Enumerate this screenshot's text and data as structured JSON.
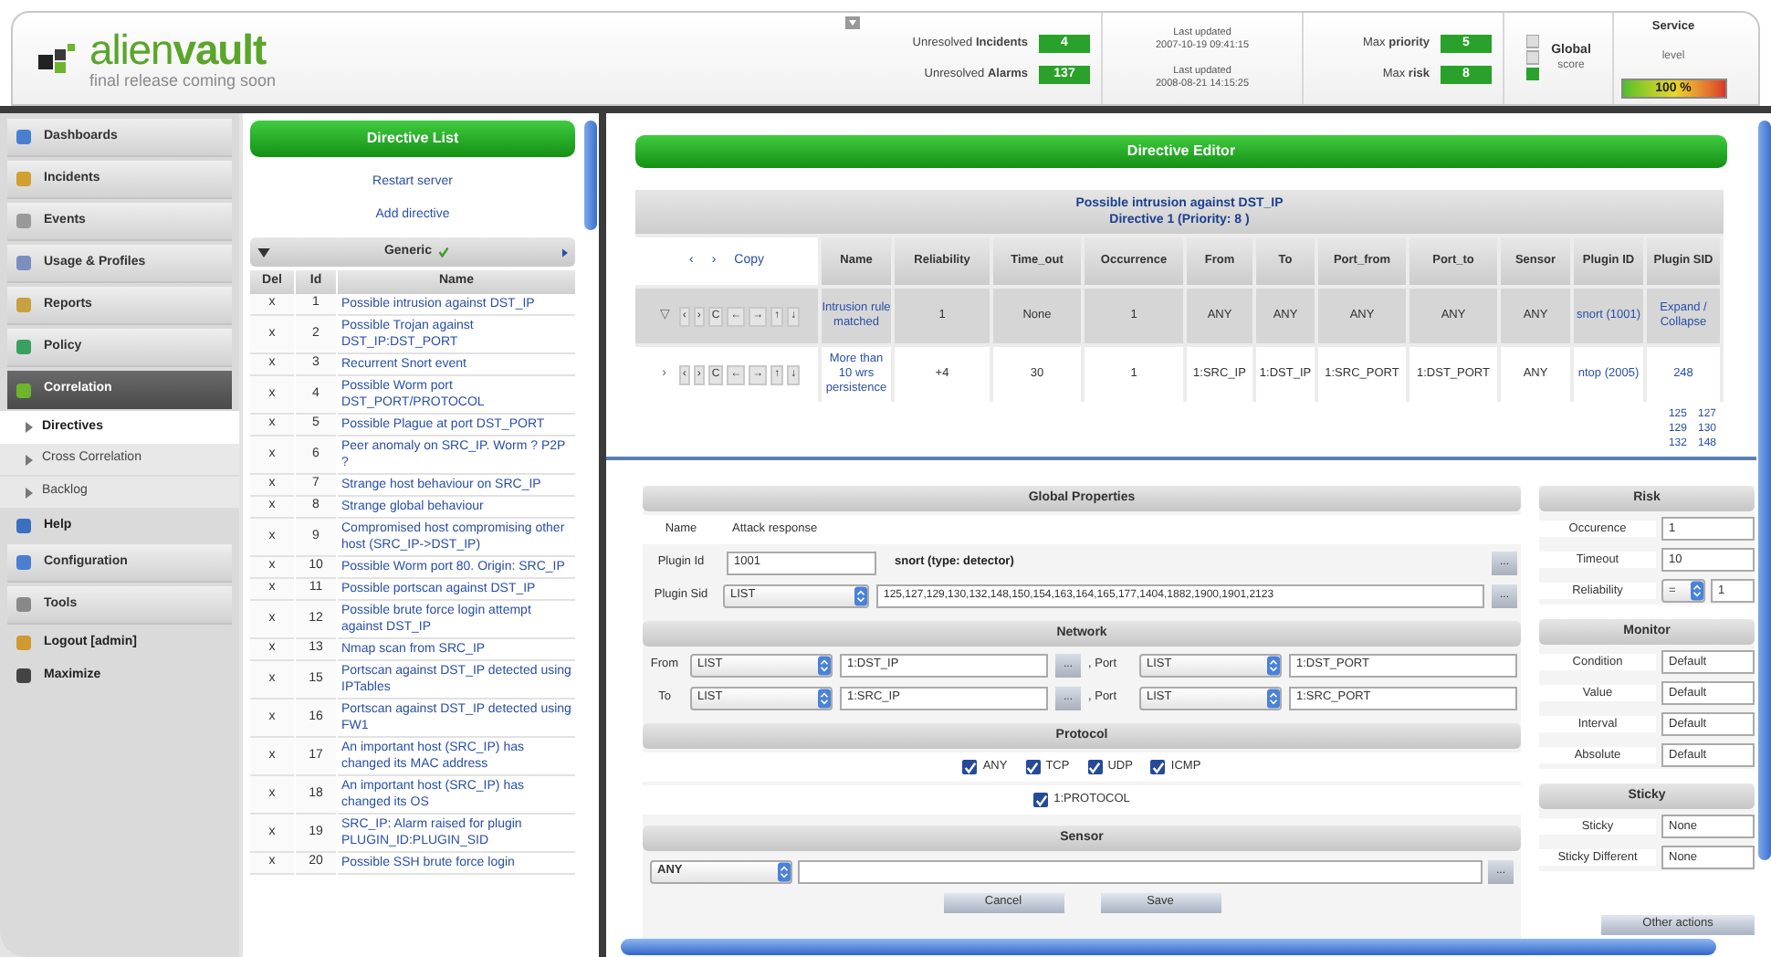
{
  "header": {
    "logo": {
      "name": "alien**vault**",
      "tagline": "final release coming soon"
    },
    "counters": [
      {
        "label": "Unresolved **Incidents**",
        "value": "4"
      },
      {
        "label": "Unresolved **Alarms**",
        "value": "137"
      }
    ],
    "updates": [
      {
        "label": "Last updated",
        "time": "2007-10-19 09:41:15"
      },
      {
        "label": "Last updated",
        "time": "2008-08-21 14:15:25"
      }
    ],
    "maxes": [
      {
        "label": "Max **priority**",
        "value": "5"
      },
      {
        "label": "Max **risk**",
        "value": "8"
      }
    ],
    "global": {
      "label": "Global",
      "sub": "score"
    },
    "service": {
      "label": "Service",
      "sub": "level",
      "value": "100 %"
    }
  },
  "sidebar": {
    "items": [
      {
        "kind": "section",
        "label": "Dashboards",
        "selected": false
      },
      {
        "kind": "section",
        "label": "Incidents",
        "selected": false
      },
      {
        "kind": "section",
        "label": "Events",
        "selected": false
      },
      {
        "kind": "section",
        "label": "Usage & Profiles",
        "selected": false
      },
      {
        "kind": "section",
        "label": "Reports",
        "selected": false
      },
      {
        "kind": "section",
        "label": "Policy",
        "selected": false
      },
      {
        "kind": "section",
        "label": "Correlation",
        "selected": true,
        "children": [
          {
            "label": "Directives",
            "selected": true
          },
          {
            "label": "Cross Correlation",
            "selected": false
          },
          {
            "label": "Backlog",
            "selected": false
          }
        ]
      },
      {
        "kind": "link",
        "label": "Help",
        "selected": false
      },
      {
        "kind": "section",
        "label": "Configuration",
        "selected": false
      },
      {
        "kind": "section",
        "label": "Tools",
        "selected": false
      },
      {
        "kind": "link",
        "label": "Logout **[admin]**",
        "selected": false
      },
      {
        "kind": "link",
        "label": "Maximize",
        "selected": false
      }
    ]
  },
  "directive_list": {
    "title": "Directive List",
    "links": [
      "Restart server",
      "Add directive"
    ],
    "group": "Generic",
    "columns": [
      "Del",
      "Id",
      "Name"
    ],
    "rows": [
      {
        "del": "x",
        "id": "1",
        "name": "Possible intrusion against DST_IP"
      },
      {
        "del": "x",
        "id": "2",
        "name": "Possible Trojan against DST_IP:DST_PORT"
      },
      {
        "del": "x",
        "id": "3",
        "name": "Recurrent Snort event"
      },
      {
        "del": "x",
        "id": "4",
        "name": "Possible Worm port DST_PORT/PROTOCOL"
      },
      {
        "del": "x",
        "id": "5",
        "name": "Possible Plague at port DST_PORT"
      },
      {
        "del": "x",
        "id": "6",
        "name": "Peer anomaly on SRC_IP. Worm ? P2P ?"
      },
      {
        "del": "x",
        "id": "7",
        "name": "Strange host behaviour on SRC_IP"
      },
      {
        "del": "x",
        "id": "8",
        "name": "Strange global behaviour"
      },
      {
        "del": "x",
        "id": "9",
        "name": "Compromised host compromising other host (SRC_IP->DST_IP)"
      },
      {
        "del": "x",
        "id": "10",
        "name": "Possible Worm port 80. Origin: SRC_IP"
      },
      {
        "del": "x",
        "id": "11",
        "name": "Possible portscan against DST_IP"
      },
      {
        "del": "x",
        "id": "12",
        "name": "Possible brute force login attempt against DST_IP"
      },
      {
        "del": "x",
        "id": "13",
        "name": "Nmap scan from SRC_IP"
      },
      {
        "del": "x",
        "id": "15",
        "name": "Portscan against DST_IP detected using IPTables"
      },
      {
        "del": "x",
        "id": "16",
        "name": "Portscan against DST_IP detected using FW1"
      },
      {
        "del": "x",
        "id": "17",
        "name": "An important host (SRC_IP) has changed its MAC address"
      },
      {
        "del": "x",
        "id": "18",
        "name": "An important host (SRC_IP) has changed its OS"
      },
      {
        "del": "x",
        "id": "19",
        "name": "SRC_IP: Alarm raised for plugin PLUGIN_ID:PLUGIN_SID"
      },
      {
        "del": "x",
        "id": "20",
        "name": "Possible SSH brute force login"
      }
    ]
  },
  "editor": {
    "title": "Directive Editor",
    "directive": {
      "name": "Possible intrusion against DST_IP",
      "info": "Directive 1 (Priority: 8 )"
    },
    "nav": [
      "‹",
      "›",
      "Copy"
    ],
    "columns": [
      "Name",
      "Reliability",
      "Time_out",
      "Occurrence",
      "From",
      "To",
      "Port_from",
      "Port_to",
      "Sensor",
      "Plugin ID",
      "Plugin SID"
    ],
    "rules": [
      {
        "selected": true,
        "toggle": "▽",
        "actions": [
          "‹",
          "›",
          "C",
          "←",
          "→",
          "↑",
          "↓"
        ],
        "cells": [
          "Intrusion rule matched",
          "1",
          "None",
          "1",
          "ANY",
          "ANY",
          "ANY",
          "ANY",
          "ANY",
          "snort (1001)",
          "Expand / Collapse"
        ]
      },
      {
        "selected": false,
        "toggle": "›",
        "actions": [
          "‹",
          "›",
          "C",
          "←",
          "→",
          "↑",
          "↓"
        ],
        "cells": [
          "More than 10 wrs persistence",
          "+4",
          "30",
          "1",
          "1:SRC_IP",
          "1:DST_IP",
          "1:SRC_PORT",
          "1:DST_PORT",
          "ANY",
          "ntop (2005)",
          "248"
        ]
      }
    ],
    "sid_links": [
      "125",
      "127",
      "129",
      "130",
      "132",
      "148"
    ]
  },
  "global_properties": {
    "title": "Global Properties",
    "name": {
      "label": "Name",
      "value": "Attack response"
    },
    "plugin_id": {
      "label": "Plugin Id",
      "value": "1001",
      "plugin": "snort (type: detector)",
      "browse": "..."
    },
    "plugin_sid": {
      "label": "Plugin Sid",
      "select": "LIST",
      "value": "125,127,129,130,132,148,150,154,163,164,165,177,1404,1882,1900,1901,2123",
      "browse": "..."
    }
  },
  "network": {
    "title": "Network",
    "rows": [
      {
        "label": "From",
        "select": "LIST",
        "value": "1:DST_IP",
        "browse": "...",
        "port_label": ", Port",
        "port_select": "LIST",
        "port_value": "1:DST_PORT"
      },
      {
        "label": "To",
        "select": "LIST",
        "value": "1:SRC_IP",
        "browse": "...",
        "port_label": ", Port",
        "port_select": "LIST",
        "port_value": "1:SRC_PORT"
      }
    ]
  },
  "protocol": {
    "title": "Protocol",
    "rows": [
      {
        "options": [
          {
            "label": "ANY",
            "checked": true
          },
          {
            "label": "TCP",
            "checked": true
          },
          {
            "label": "UDP",
            "checked": true
          },
          {
            "label": "ICMP",
            "checked": true
          }
        ]
      },
      {
        "options": [
          {
            "label": "1:PROTOCOL",
            "checked": true
          }
        ]
      }
    ]
  },
  "sensor": {
    "title": "Sensor",
    "select": "ANY",
    "browse": "..."
  },
  "buttons": [
    "Cancel",
    "Save"
  ],
  "risk": {
    "title": "Risk",
    "rows": [
      {
        "label": "Occurence",
        "value": "1"
      },
      {
        "label": "Timeout",
        "value": "10"
      },
      {
        "label": "Reliability",
        "select": "=",
        "value": "1"
      }
    ]
  },
  "monitor": {
    "title": "Monitor",
    "rows": [
      {
        "label": "Condition",
        "value": "Default"
      },
      {
        "label": "Value",
        "value": "Default"
      },
      {
        "label": "Interval",
        "value": "Default"
      },
      {
        "label": "Absolute",
        "value": "Default"
      }
    ]
  },
  "sticky": {
    "title": "Sticky",
    "rows": [
      {
        "label": "Sticky",
        "value": "None"
      },
      {
        "label": "Sticky Different",
        "value": "None"
      }
    ]
  },
  "other_actions": "Other actions"
}
